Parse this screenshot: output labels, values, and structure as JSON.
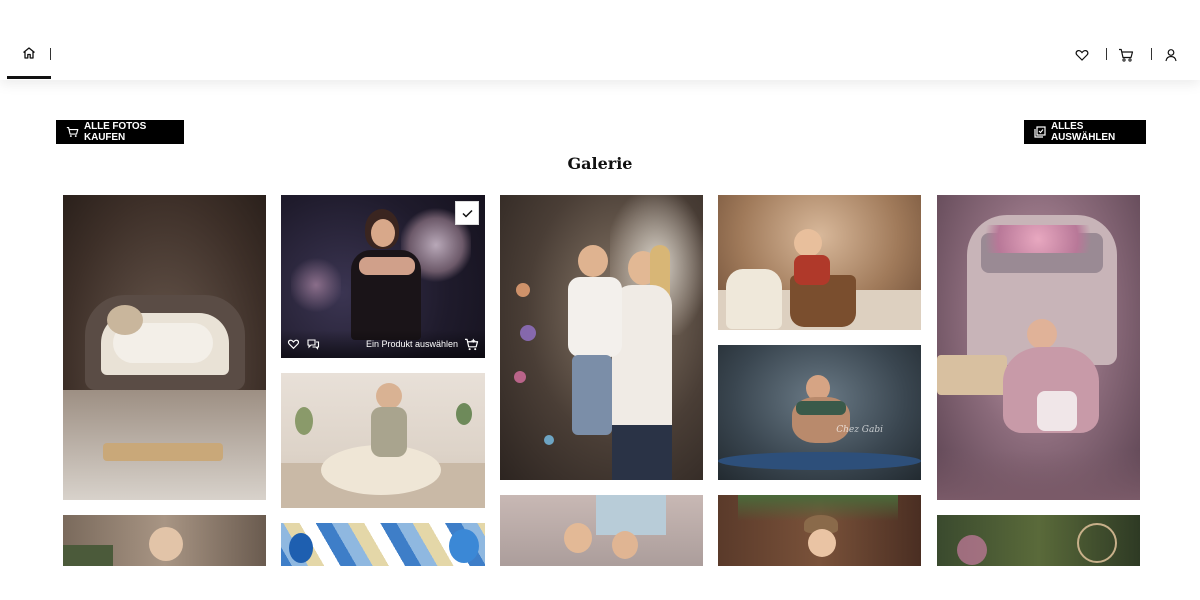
{
  "nav": {
    "home_icon": "home-icon",
    "favorites_icon": "heart-icon",
    "cart_icon": "cart-icon",
    "account_icon": "user-icon"
  },
  "actions": {
    "buy_all_label": "ALLE FOTOS KAUFEN",
    "select_all_label": "ALLES AUSWÄHLEN"
  },
  "gallery": {
    "title": "Galerie",
    "hovered_photo": {
      "select_product_label": "Ein Produkt auswählen"
    },
    "photos": [
      {
        "subject": "newborn-on-armchair"
      },
      {
        "subject": "woman-floral-backdrop"
      },
      {
        "subject": "mother-and-boy"
      },
      {
        "subject": "baby-in-tub"
      },
      {
        "subject": "toddler-vintage-van"
      },
      {
        "subject": "toddler-on-blanket"
      },
      {
        "subject": "maternity-portrait"
      }
    ]
  },
  "colors": {
    "button_bg": "#000000",
    "button_text": "#ffffff",
    "background": "#ffffff"
  }
}
